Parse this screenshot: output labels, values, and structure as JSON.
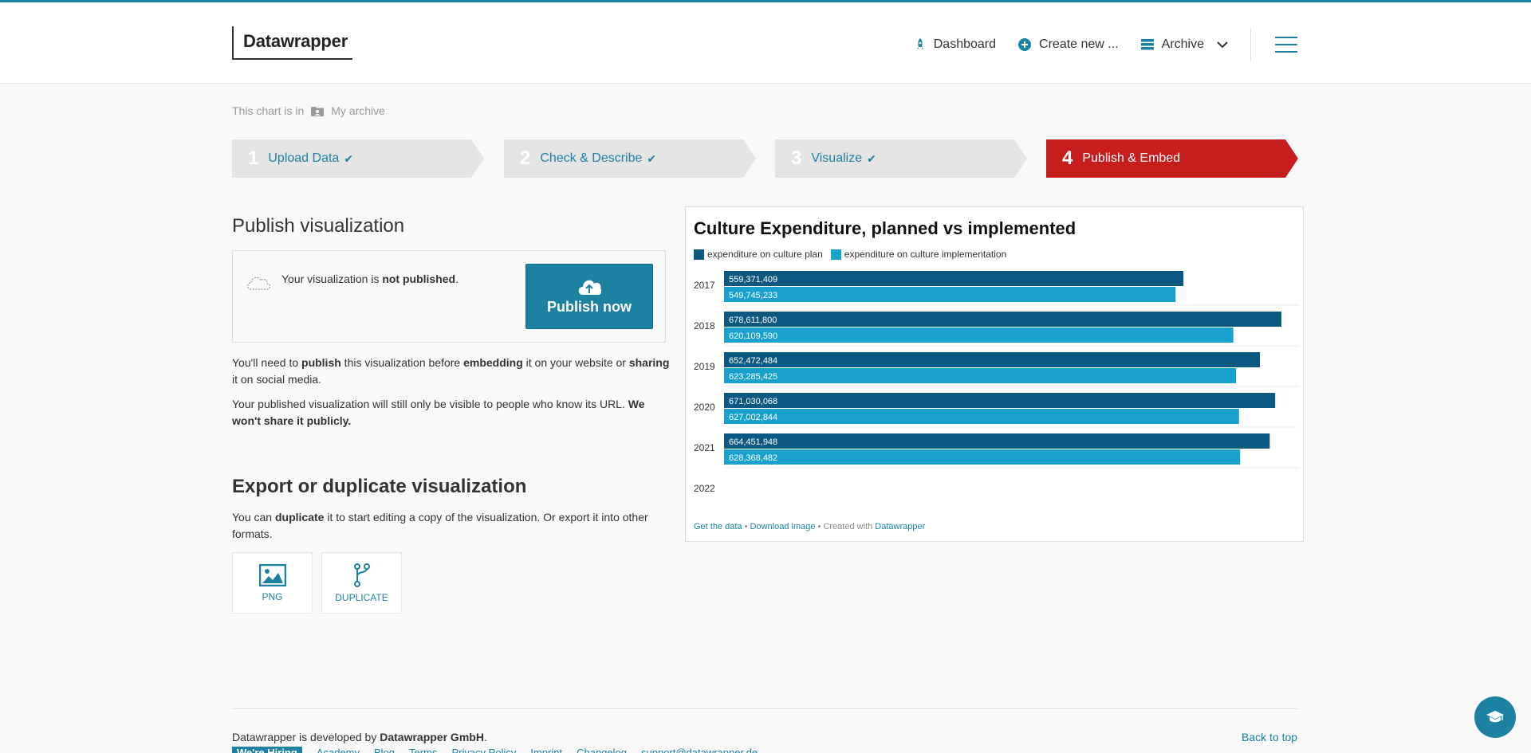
{
  "app": {
    "logo": "Datawrapper"
  },
  "nav": {
    "dashboard": "Dashboard",
    "create_new": "Create new ...",
    "archive": "Archive"
  },
  "breadcrumb": {
    "prefix": "This chart is in",
    "folder": "My archive"
  },
  "steps": [
    {
      "num": "1",
      "label": "Upload Data",
      "done": true
    },
    {
      "num": "2",
      "label": "Check & Describe",
      "done": true
    },
    {
      "num": "3",
      "label": "Visualize",
      "done": true
    },
    {
      "num": "4",
      "label": "Publish & Embed",
      "done": false
    }
  ],
  "publish": {
    "heading": "Publish visualization",
    "status_prefix": "Your visualization is ",
    "status_bold": "not published",
    "status_suffix": ".",
    "button": "Publish now",
    "p1_a": "You'll need to ",
    "p1_b": "publish",
    "p1_c": " this visualization before ",
    "p1_d": "embedding",
    "p1_e": " it on your website or ",
    "p1_f": "sharing",
    "p1_g": " it on social media.",
    "p2_a": "Your published visualization will still only be visible to people who know its URL. ",
    "p2_b": "We won't share it publicly."
  },
  "export": {
    "heading": "Export or duplicate visualization",
    "p_a": "You can ",
    "p_b": "duplicate",
    "p_c": " it to start editing a copy of the visualization. Or export it into other formats.",
    "png": "PNG",
    "duplicate": "DUPLICATE"
  },
  "colors": {
    "accent": "#1d81a2",
    "active_step": "#c71e1d",
    "series_1": "#0d5880",
    "series_2": "#18a1cd"
  },
  "chart_data": {
    "type": "bar",
    "title": "Culture Expenditure, planned vs implemented",
    "categories": [
      "2017",
      "2018",
      "2019",
      "2020",
      "2021",
      "2022"
    ],
    "series": [
      {
        "name": "expenditure on culture plan",
        "values": [
          559371409,
          678611800,
          652472484,
          671030068,
          664451948,
          null
        ],
        "labels": [
          "559,371,409",
          "678,611,800",
          "652,472,484",
          "671,030,068",
          "664,451,948",
          ""
        ]
      },
      {
        "name": "expenditure on culture implementation",
        "values": [
          549745233,
          620109590,
          623285425,
          627002844,
          628368482,
          null
        ],
        "labels": [
          "549,745,233",
          "620,109,590",
          "623,285,425",
          "627,002,844",
          "628,368,482",
          ""
        ]
      }
    ],
    "xlim": [
      0,
      700000000
    ],
    "legend": "top-left",
    "footer": {
      "get_data": "Get the data",
      "download": "Download image",
      "created": "Created with",
      "brand": "Datawrapper",
      "sep": "•"
    }
  },
  "footer": {
    "developed_prefix": "Datawrapper is developed by ",
    "developed_by": "Datawrapper GmbH",
    "developed_suffix": ".",
    "back_to_top": "Back to top",
    "hiring": "We're Hiring",
    "links": [
      "Academy",
      "Blog",
      "Terms",
      "Privacy Policy",
      "Imprint",
      "Changelog",
      "support@datawrapper.de"
    ]
  }
}
